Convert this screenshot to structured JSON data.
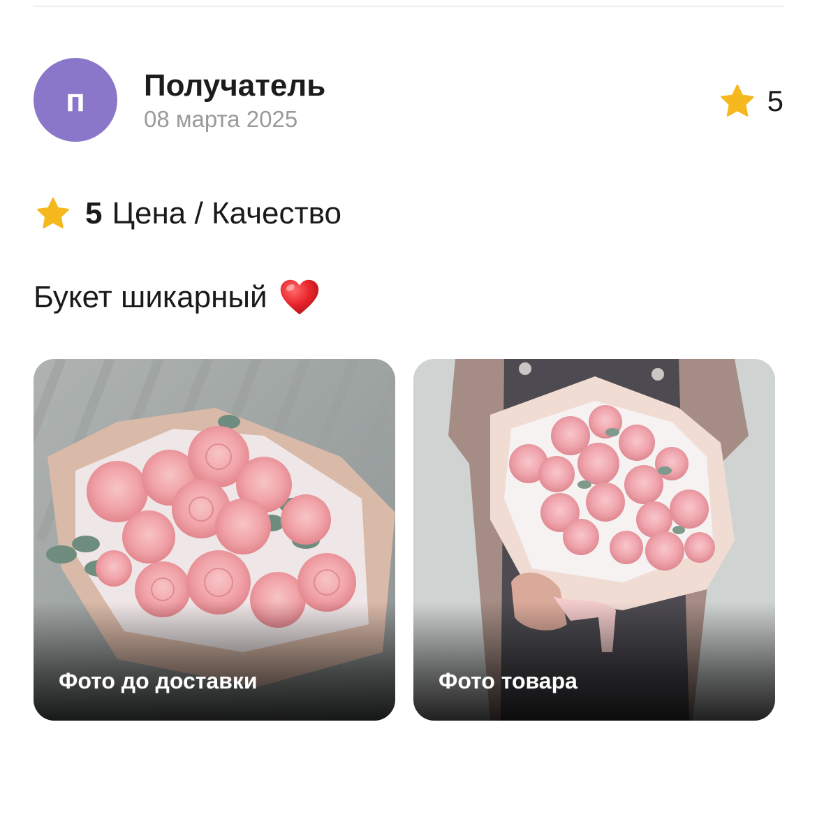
{
  "review": {
    "author": {
      "initial": "п",
      "name": "Получатель",
      "avatar_color": "#8a77c9"
    },
    "date": "08 марта 2025",
    "rating": "5",
    "criteria": {
      "value": "5",
      "label": "Цена / Качество"
    },
    "text": "Букет шикарный",
    "text_emoji": "heart-icon",
    "photos": [
      {
        "caption": "Фото до доставки",
        "subject": "pink peony roses bouquet in kraft paper"
      },
      {
        "caption": "Фото товара",
        "subject": "person holding pink peony bouquet"
      }
    ]
  },
  "colors": {
    "star": "#f5b81f",
    "avatar": "#8a77c9",
    "heart": "#e8262c",
    "muted_text": "#9a9a9a"
  }
}
